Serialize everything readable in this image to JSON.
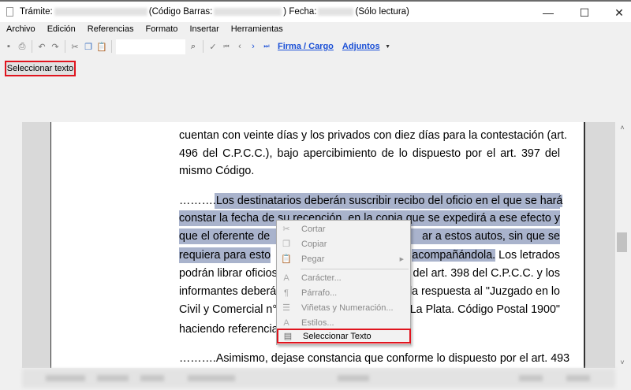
{
  "window": {
    "title_label": "Trámite:",
    "barcode_label": "(Código Barras:",
    "date_label": ") Fecha:",
    "mode": "(Sólo lectura)",
    "minimize": "—",
    "maximize": "☐",
    "close": "✕"
  },
  "menubar": [
    "Archivo",
    "Edición",
    "Referencias",
    "Formato",
    "Insertar",
    "Herramientas"
  ],
  "toolbar": {
    "search_value": "",
    "firma_link": "Firma / Cargo",
    "adjuntos_link": "Adjuntos"
  },
  "select_text_button": "Seleccionar texto",
  "document": {
    "lines": [
      {
        "a": "cuentan con veinte días y los privados con diez días para la contestación (art.",
        "b": ""
      },
      {
        "a": "496 del C.P.C.C.), bajo apercibimiento de lo dispuesto por el art. 397 del",
        "b": ""
      },
      {
        "a": "mismo Código.",
        "b": ""
      },
      {
        "pre": "……….",
        "a": "Los destinatarios deberán suscribir recibo del oficio en el que se hará",
        "b": ""
      },
      {
        "a": "constar la fecha de su recepción, en la copia que se expedirá a ese efecto y",
        "b": ""
      },
      {
        "a": "que el oferente de",
        "b": "ar a estos autos, sin que se"
      },
      {
        "a": "requiera para esto",
        "b": "acompañándola.",
        "c": " Los letrados"
      },
      {
        "a": "podrán librar oficios",
        "b": "del art. 398 del C.P.C.C. y los"
      },
      {
        "a": "informantes deberán",
        "b": "la respuesta al \"Juzgado en lo"
      },
      {
        "a": "Civil y Comercial n°",
        "b": "La Plata. Código Postal 1900\""
      },
      {
        "a": "haciendo referencia",
        "b": ""
      },
      {
        "a": "……….Asimismo, dejase constancia que conforme lo dispuesto por el art. 493",
        "b": ""
      }
    ]
  },
  "context_menu": {
    "items": [
      {
        "label": "Cortar",
        "icon": "scissors-icon",
        "enabled": false
      },
      {
        "label": "Copiar",
        "icon": "copy-icon",
        "enabled": false
      },
      {
        "label": "Pegar",
        "icon": "paste-icon",
        "enabled": false,
        "submenu": true
      },
      {
        "label": "Carácter...",
        "icon": "font-icon",
        "enabled": false
      },
      {
        "label": "Párrafo...",
        "icon": "paragraph-icon",
        "enabled": false
      },
      {
        "label": "Viñetas y Numeración...",
        "icon": "list-icon",
        "enabled": false
      },
      {
        "label": "Estilos...",
        "icon": "styles-icon",
        "enabled": false
      },
      {
        "label": "Seleccionar Texto",
        "icon": "document-icon",
        "enabled": true
      }
    ]
  },
  "colors": {
    "highlight": "#e0141e",
    "selection": "#a9b3cc",
    "link": "#1a4fd6"
  }
}
